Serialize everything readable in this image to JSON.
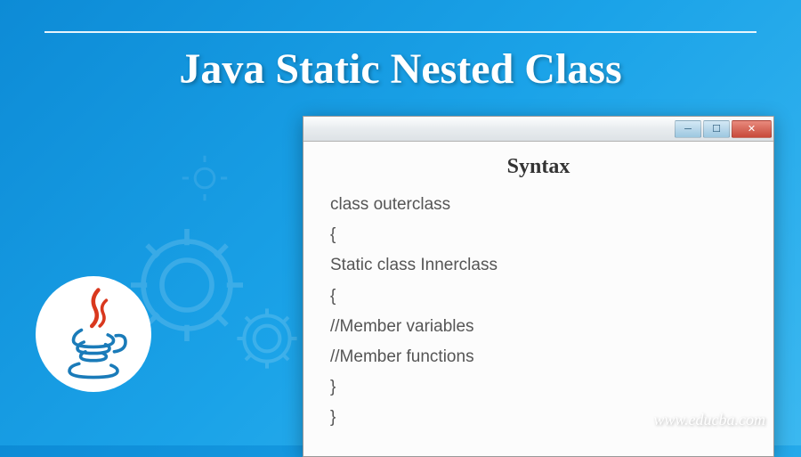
{
  "title": "Java Static Nested Class",
  "window": {
    "heading": "Syntax",
    "lines": [
      "class outerclass",
      "{",
      "Static class Innerclass",
      "{",
      "//Member variables",
      "//Member functions",
      "}",
      "}"
    ]
  },
  "website": "www.educba.com",
  "icons": {
    "minimize": "─",
    "maximize": "☐",
    "close": "✕"
  }
}
